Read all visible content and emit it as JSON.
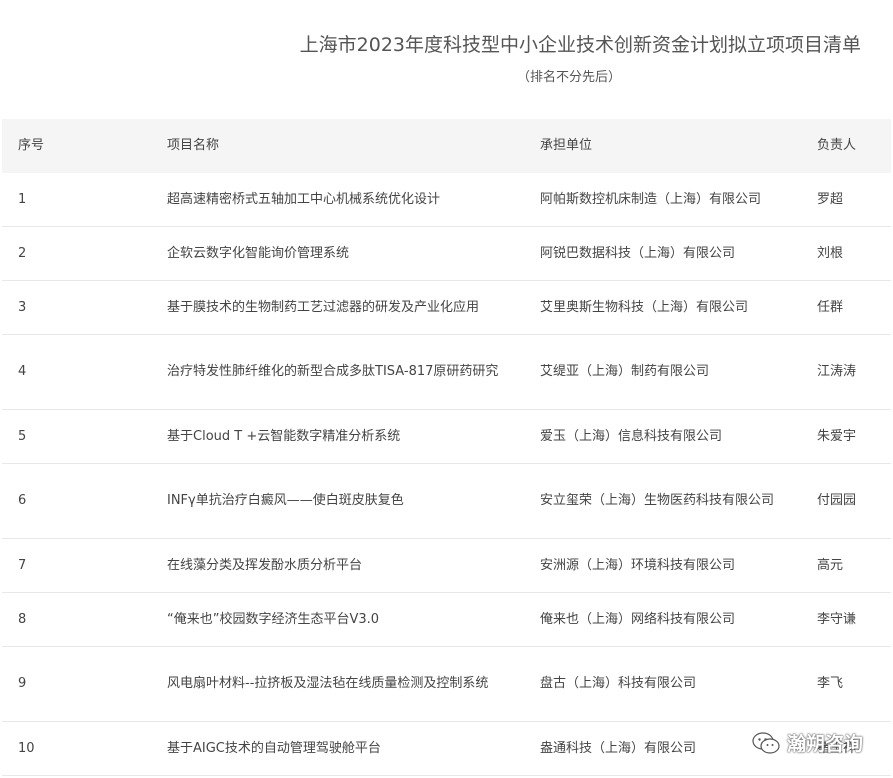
{
  "document": {
    "title": "上海市2023年度科技型中小企业技术创新资金计划拟立项项目清单",
    "subtitle": "（排名不分先后）"
  },
  "table": {
    "headers": {
      "no": "序号",
      "name": "项目名称",
      "unit": "承担单位",
      "person": "负责人"
    },
    "rows": [
      {
        "no": "1",
        "name": "超高速精密桥式五轴加工中心机械系统优化设计",
        "unit": "阿帕斯数控机床制造（上海）有限公司",
        "person": "罗超"
      },
      {
        "no": "2",
        "name": "企软云数字化智能询价管理系统",
        "unit": "阿锐巴数据科技（上海）有限公司",
        "person": "刘根"
      },
      {
        "no": "3",
        "name": "基于膜技术的生物制药工艺过滤器的研发及产业化应用",
        "unit": "艾里奥斯生物科技（上海）有限公司",
        "person": "任群"
      },
      {
        "no": "4",
        "name": "治疗特发性肺纤维化的新型合成多肽TISA-817原研药研究",
        "unit": "艾缇亚（上海）制药有限公司",
        "person": "江涛涛"
      },
      {
        "no": "5",
        "name": "基于Cloud T +云智能数字精准分析系统",
        "unit": "爱玉（上海）信息科技有限公司",
        "person": "朱爱宇"
      },
      {
        "no": "6",
        "name": "INFγ单抗治疗白癜风——使白斑皮肤复色",
        "unit": "安立玺荣（上海）生物医药科技有限公司",
        "person": "付园园"
      },
      {
        "no": "7",
        "name": "在线藻分类及挥发酚水质分析平台",
        "unit": "安洲源（上海）环境科技有限公司",
        "person": "高元"
      },
      {
        "no": "8",
        "name": "“俺来也”校园数字经济生态平台V3.0",
        "unit": "俺来也（上海）网络科技有限公司",
        "person": "李守谦"
      },
      {
        "no": "9",
        "name": "风电扇叶材料--拉挤板及湿法毡在线质量检测及控制系统",
        "unit": "盘古（上海）科技有限公司",
        "person": "李飞"
      },
      {
        "no": "10",
        "name": "基于AIGC技术的自动管理驾驶舱平台",
        "unit": "盎通科技（上海）有限公司",
        "person": "褚玉祥"
      }
    ]
  },
  "watermark": {
    "icon": "wechat-icon",
    "text": "瀚朔咨询"
  }
}
